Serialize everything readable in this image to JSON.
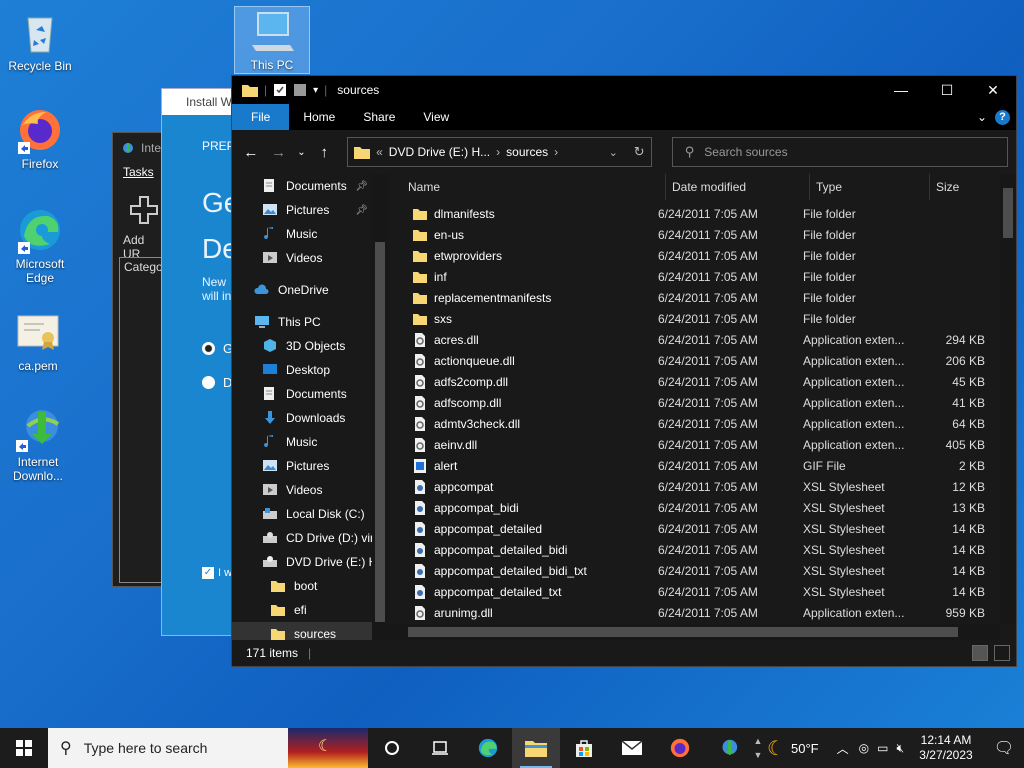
{
  "desktop": {
    "icons": [
      {
        "label": "Recycle Bin"
      },
      {
        "label": "This PC"
      },
      {
        "label": "Firefox"
      },
      {
        "label": "Microsoft Edge"
      },
      {
        "label": "ca.pem"
      },
      {
        "label": "Internet Downlo..."
      }
    ]
  },
  "background_windows": {
    "idm": {
      "title": "Inte",
      "tab": "Tasks",
      "add": "Add UR",
      "category": "Categor"
    },
    "install": {
      "title": "Install W",
      "tab": "PREPA",
      "big1": "Ge",
      "big2": "De",
      "text1": "New",
      "text2": "will in",
      "opt1": "G",
      "opt2": "D",
      "check": "I w"
    }
  },
  "explorer": {
    "title": "sources",
    "ribbon": {
      "file": "File",
      "home": "Home",
      "share": "Share",
      "view": "View"
    },
    "address": {
      "prefix": "«",
      "drive": "DVD Drive (E:) H...",
      "folder": "sources"
    },
    "search_placeholder": "Search sources",
    "columns": {
      "name": "Name",
      "date": "Date modified",
      "type": "Type",
      "size": "Size"
    },
    "nav": [
      {
        "label": "Documents",
        "pin": true
      },
      {
        "label": "Pictures",
        "pin": true
      },
      {
        "label": "Music"
      },
      {
        "label": "Videos"
      },
      {
        "label": "OneDrive"
      },
      {
        "label": "This PC"
      },
      {
        "label": "3D Objects"
      },
      {
        "label": "Desktop"
      },
      {
        "label": "Documents"
      },
      {
        "label": "Downloads"
      },
      {
        "label": "Music"
      },
      {
        "label": "Pictures"
      },
      {
        "label": "Videos"
      },
      {
        "label": "Local Disk (C:)"
      },
      {
        "label": "CD Drive (D:) virt"
      },
      {
        "label": "DVD Drive (E:) H"
      },
      {
        "label": "boot"
      },
      {
        "label": "efi"
      },
      {
        "label": "sources"
      }
    ],
    "files": [
      {
        "name": "dlmanifests",
        "date": "6/24/2011 7:05 AM",
        "type": "File folder",
        "size": "",
        "kind": "folder"
      },
      {
        "name": "en-us",
        "date": "6/24/2011 7:05 AM",
        "type": "File folder",
        "size": "",
        "kind": "folder"
      },
      {
        "name": "etwproviders",
        "date": "6/24/2011 7:05 AM",
        "type": "File folder",
        "size": "",
        "kind": "folder"
      },
      {
        "name": "inf",
        "date": "6/24/2011 7:05 AM",
        "type": "File folder",
        "size": "",
        "kind": "folder"
      },
      {
        "name": "replacementmanifests",
        "date": "6/24/2011 7:05 AM",
        "type": "File folder",
        "size": "",
        "kind": "folder"
      },
      {
        "name": "sxs",
        "date": "6/24/2011 7:05 AM",
        "type": "File folder",
        "size": "",
        "kind": "folder"
      },
      {
        "name": "acres.dll",
        "date": "6/24/2011 7:05 AM",
        "type": "Application exten...",
        "size": "294 KB",
        "kind": "dll"
      },
      {
        "name": "actionqueue.dll",
        "date": "6/24/2011 7:05 AM",
        "type": "Application exten...",
        "size": "206 KB",
        "kind": "dll"
      },
      {
        "name": "adfs2comp.dll",
        "date": "6/24/2011 7:05 AM",
        "type": "Application exten...",
        "size": "45 KB",
        "kind": "dll"
      },
      {
        "name": "adfscomp.dll",
        "date": "6/24/2011 7:05 AM",
        "type": "Application exten...",
        "size": "41 KB",
        "kind": "dll"
      },
      {
        "name": "admtv3check.dll",
        "date": "6/24/2011 7:05 AM",
        "type": "Application exten...",
        "size": "64 KB",
        "kind": "dll"
      },
      {
        "name": "aeinv.dll",
        "date": "6/24/2011 7:05 AM",
        "type": "Application exten...",
        "size": "405 KB",
        "kind": "dll"
      },
      {
        "name": "alert",
        "date": "6/24/2011 7:05 AM",
        "type": "GIF File",
        "size": "2 KB",
        "kind": "gif"
      },
      {
        "name": "appcompat",
        "date": "6/24/2011 7:05 AM",
        "type": "XSL Stylesheet",
        "size": "12 KB",
        "kind": "xsl"
      },
      {
        "name": "appcompat_bidi",
        "date": "6/24/2011 7:05 AM",
        "type": "XSL Stylesheet",
        "size": "13 KB",
        "kind": "xsl"
      },
      {
        "name": "appcompat_detailed",
        "date": "6/24/2011 7:05 AM",
        "type": "XSL Stylesheet",
        "size": "14 KB",
        "kind": "xsl"
      },
      {
        "name": "appcompat_detailed_bidi",
        "date": "6/24/2011 7:05 AM",
        "type": "XSL Stylesheet",
        "size": "14 KB",
        "kind": "xsl"
      },
      {
        "name": "appcompat_detailed_bidi_txt",
        "date": "6/24/2011 7:05 AM",
        "type": "XSL Stylesheet",
        "size": "14 KB",
        "kind": "xsl"
      },
      {
        "name": "appcompat_detailed_txt",
        "date": "6/24/2011 7:05 AM",
        "type": "XSL Stylesheet",
        "size": "14 KB",
        "kind": "xsl"
      },
      {
        "name": "arunimg.dll",
        "date": "6/24/2011 7:05 AM",
        "type": "Application exten...",
        "size": "959 KB",
        "kind": "dll"
      }
    ],
    "status": "171 items"
  },
  "taskbar": {
    "search_placeholder": "Type here to search",
    "weather": "50°F",
    "time": "12:14 AM",
    "date": "3/27/2023"
  },
  "colors": {
    "accent": "#1979ca",
    "folder": "#f7d774",
    "bg": "#191919"
  }
}
